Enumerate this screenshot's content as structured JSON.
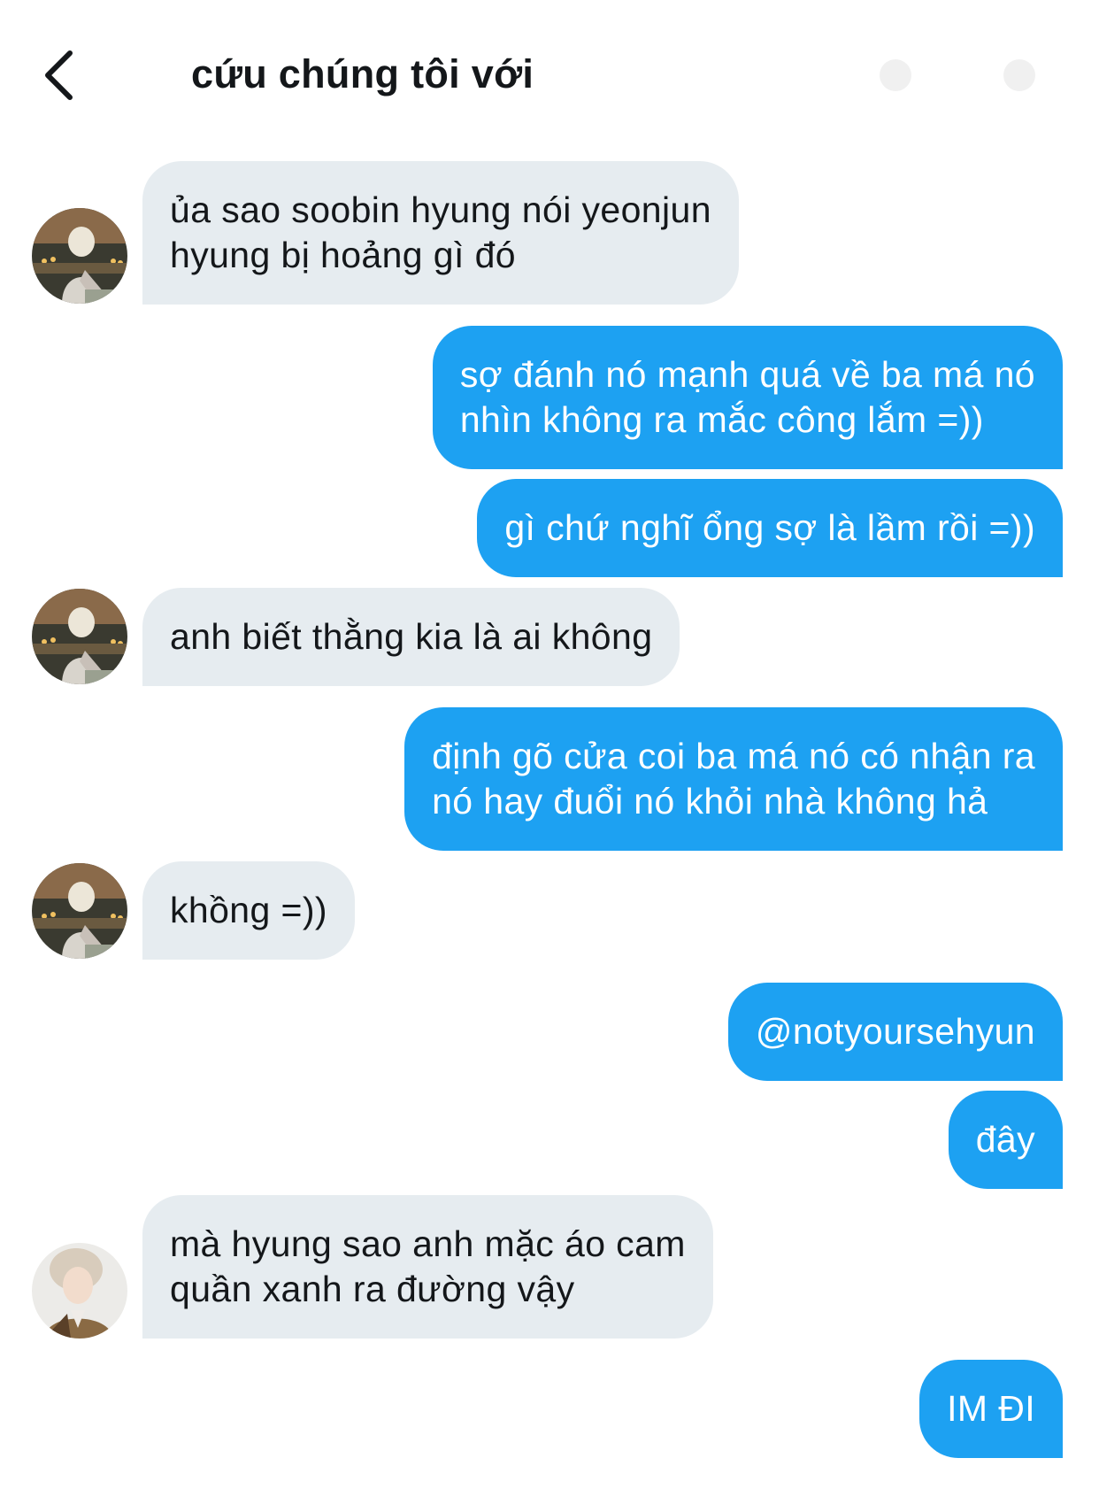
{
  "header": {
    "title": "cứu chúng tôi với",
    "back_icon": "chevron-left-icon",
    "info_icon": "info-icon"
  },
  "colors": {
    "incoming_bubble": "#e6ecf0",
    "outgoing_bubble": "#1da1f2",
    "outgoing_text": "#ffffff",
    "incoming_text": "#14171a"
  },
  "messages": [
    {
      "direction": "in",
      "avatar": "avatar-1",
      "lines": [
        "ủa sao soobin hyung nói yeonjun",
        "hyung bị hoảng gì đó"
      ]
    },
    {
      "direction": "out",
      "lines": [
        "sợ đánh nó mạnh quá về ba má nó",
        "nhìn không ra mắc công lắm =))"
      ]
    },
    {
      "direction": "out",
      "lines": [
        "gì chứ nghĩ ổng sợ là lầm rồi =))"
      ]
    },
    {
      "direction": "in",
      "avatar": "avatar-1",
      "lines": [
        "anh biết thằng kia là ai không"
      ]
    },
    {
      "direction": "out",
      "lines": [
        "định gõ cửa coi ba má nó có nhận ra",
        "nó hay đuổi nó khỏi nhà không hả"
      ]
    },
    {
      "direction": "in",
      "avatar": "avatar-1",
      "lines": [
        "khồng =))"
      ]
    },
    {
      "direction": "out",
      "lines": [
        "@notyoursehyun"
      ]
    },
    {
      "direction": "out",
      "lines": [
        "đây"
      ]
    },
    {
      "direction": "in",
      "avatar": "avatar-2",
      "lines": [
        "mà hyung sao anh mặc áo cam",
        "quần xanh ra đường vậy"
      ]
    },
    {
      "direction": "out",
      "lines": [
        "IM ĐI"
      ]
    }
  ]
}
